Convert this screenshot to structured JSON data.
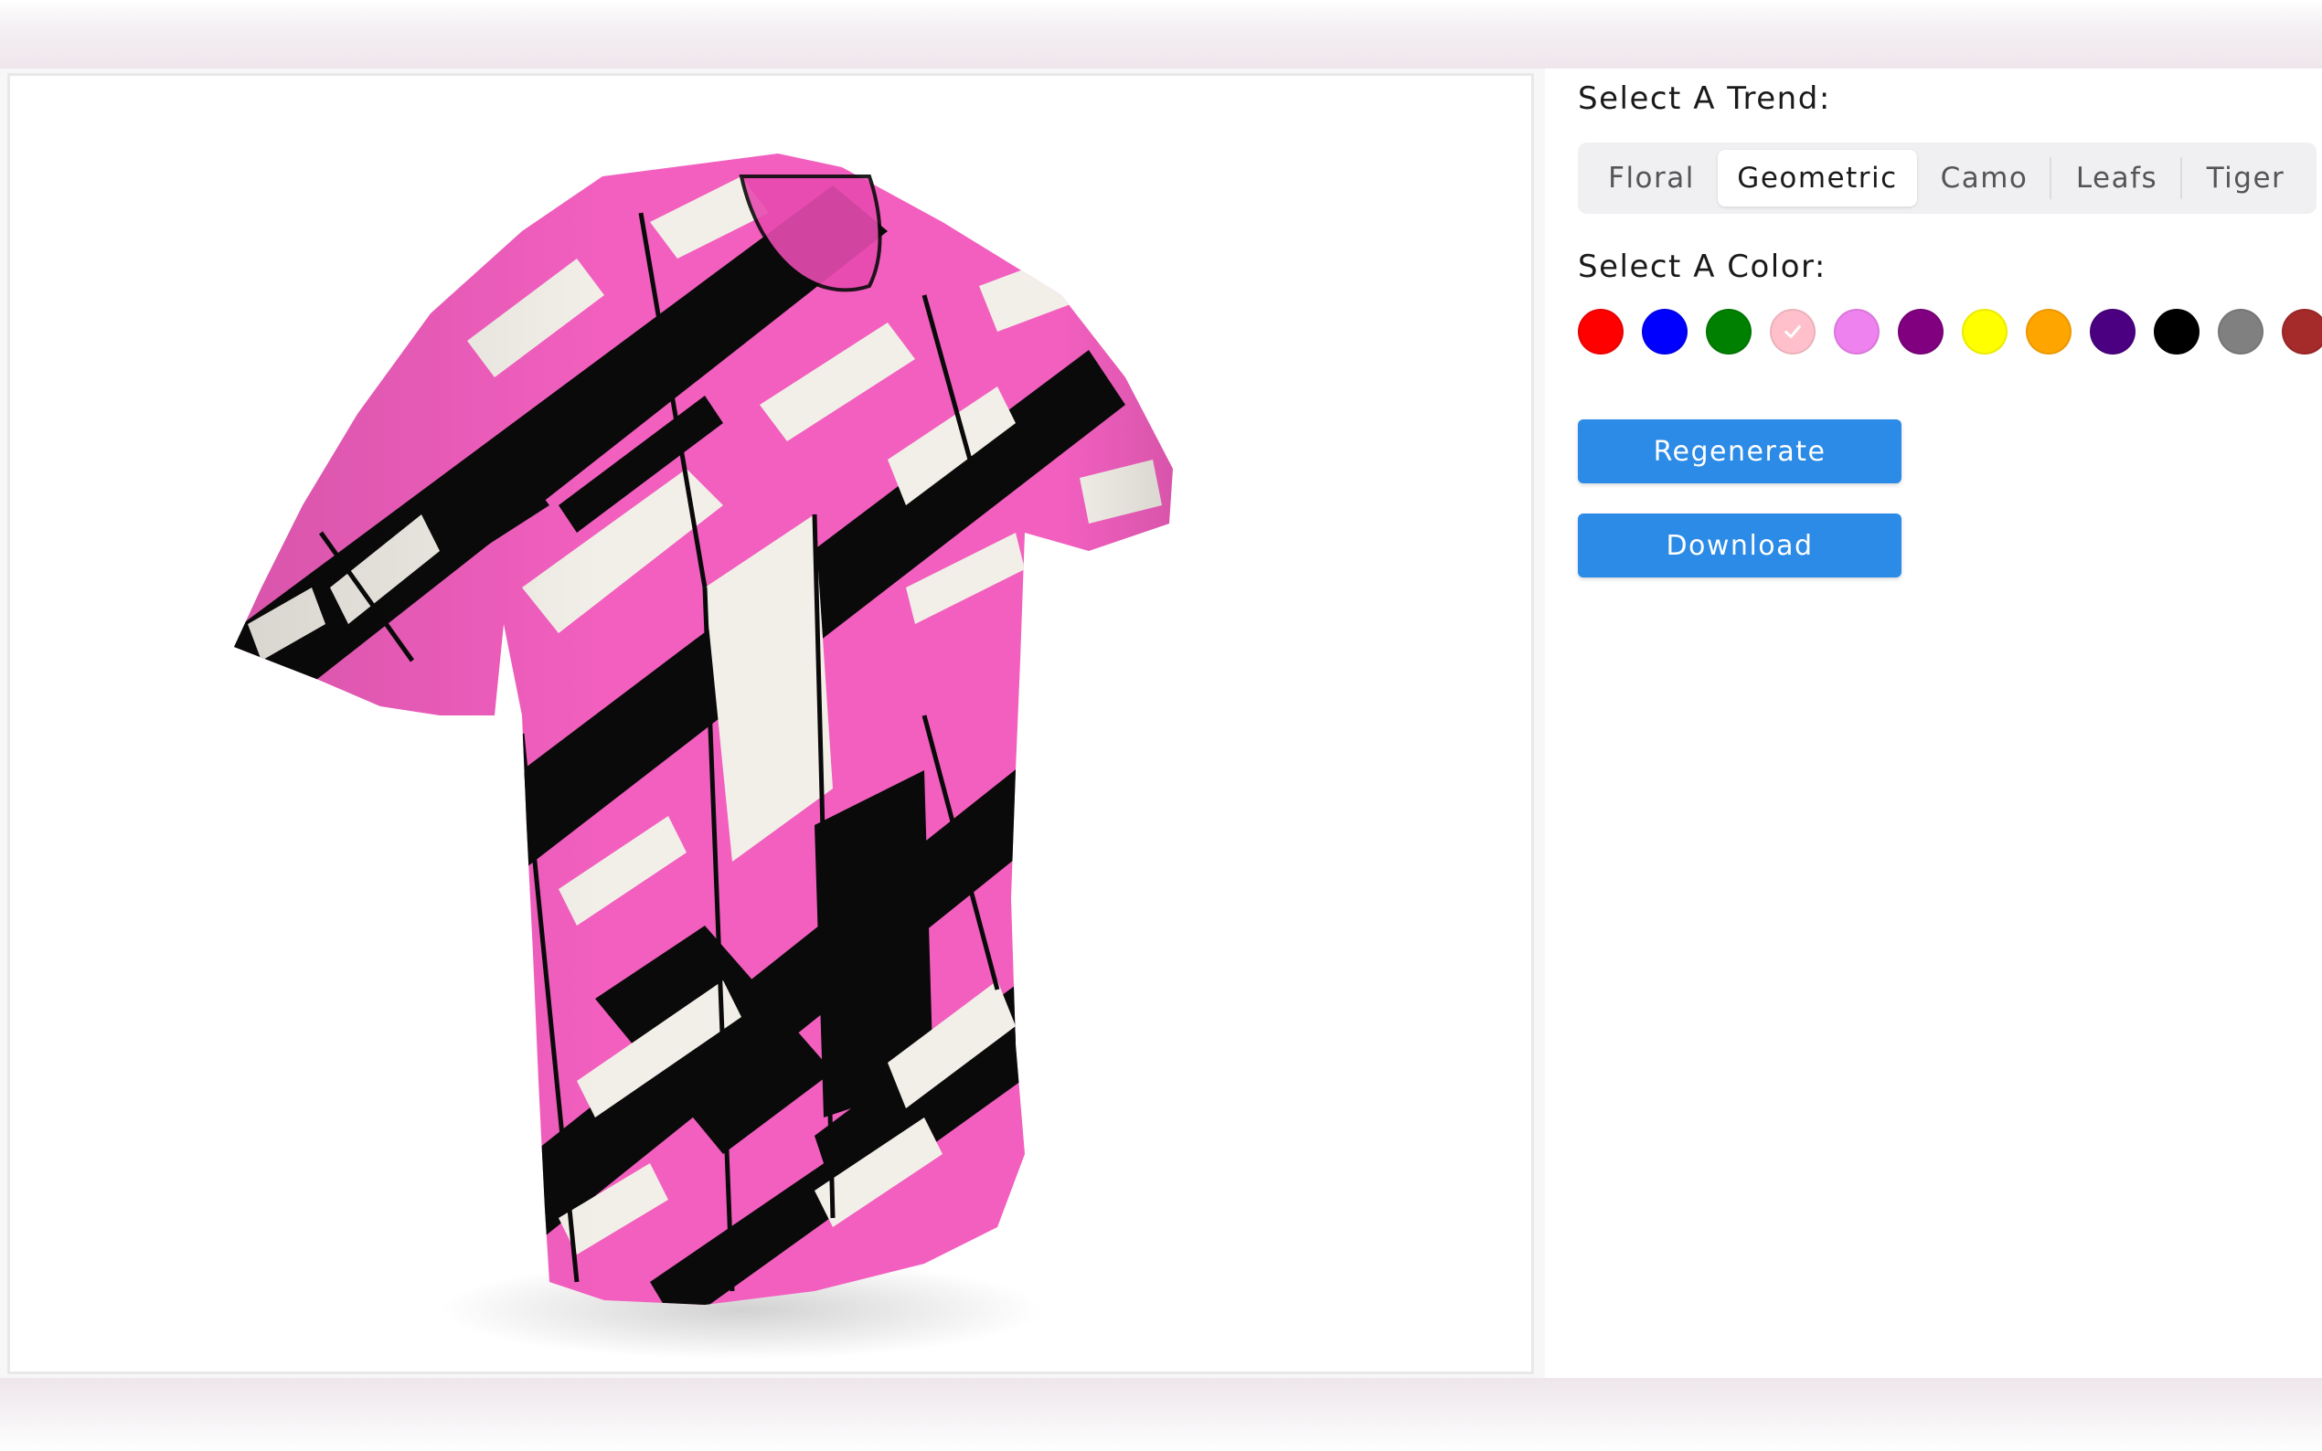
{
  "viewer": {
    "image_label": "3D t-shirt preview with pink geometric pattern"
  },
  "trend": {
    "label": "Select A Trend:",
    "options": [
      "Floral",
      "Geometric",
      "Camo",
      "Leafs",
      "Tiger"
    ],
    "selected": "Geometric"
  },
  "color": {
    "label": "Select A Color:",
    "swatches": [
      "#ff0000",
      "#0000ff",
      "#008000",
      "#ffc0cb",
      "#ee82ee",
      "#800080",
      "#ffff00",
      "#ffa500",
      "#4b0082",
      "#000000",
      "#808080",
      "#a52a2a"
    ],
    "selected": "#ffc0cb"
  },
  "buttons": {
    "regenerate": "Regenerate",
    "download": "Download"
  },
  "colors": {
    "accent": "#2b8be6",
    "pattern_pink": "#f25fbf",
    "pattern_black": "#0a0a0a",
    "pattern_white": "#f2efe8"
  }
}
